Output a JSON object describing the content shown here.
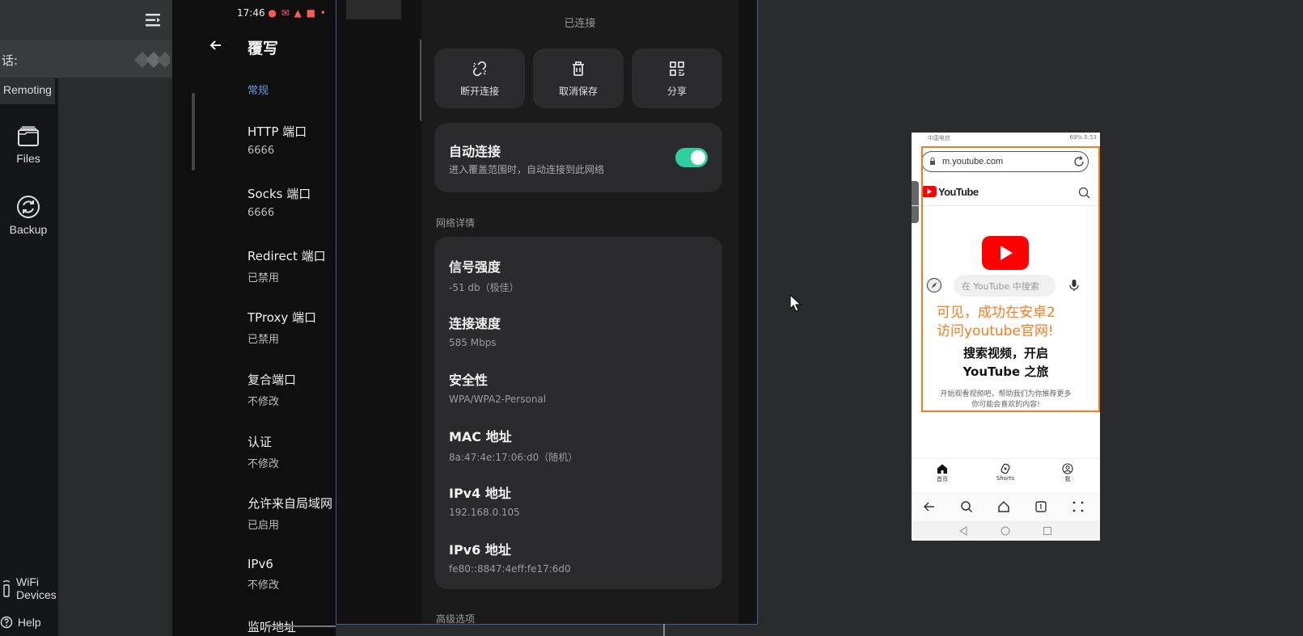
{
  "left_app": {
    "chat_label": "话:",
    "nav": {
      "remoting": "Remoting",
      "files": "Files",
      "backup": "Backup",
      "wifi_devices_line1": "WiFi",
      "wifi_devices_line2": "Devices",
      "help": "Help"
    }
  },
  "override": {
    "status_time": "17:46",
    "title": "覆写",
    "section": "常规",
    "options": [
      {
        "title": "HTTP 端口",
        "value": "6666"
      },
      {
        "title": "Socks 端口",
        "value": "6666"
      },
      {
        "title": "Redirect 端口",
        "value": "已禁用"
      },
      {
        "title": "TProxy 端口",
        "value": "已禁用"
      },
      {
        "title": "复合端口",
        "value": "不修改"
      },
      {
        "title": "认证",
        "value": "不修改"
      },
      {
        "title": "允许来自局域网",
        "value": "已启用"
      },
      {
        "title": "IPv6",
        "value": "不修改"
      },
      {
        "title": "监听地址",
        "value": ""
      }
    ]
  },
  "wifi_details": {
    "status": "已连接",
    "actions": {
      "disconnect": "断开连接",
      "forget": "取消保存",
      "share": "分享"
    },
    "auto_connect": {
      "title": "自动连接",
      "desc": "进入覆盖范围时，自动连接到此网络",
      "enabled": true
    },
    "section_details": "网络详情",
    "details": [
      {
        "title": "信号强度",
        "value": "-51 db（极佳）"
      },
      {
        "title": "连接速度",
        "value": "585 Mbps"
      },
      {
        "title": "安全性",
        "value": "WPA/WPA2-Personal"
      },
      {
        "title": "MAC 地址",
        "value": "8a:47:4e:17:06:d0（随机）"
      },
      {
        "title": "IPv4 地址",
        "value": "192.168.0.105"
      },
      {
        "title": "IPv6 地址",
        "value": "fe80::8847:4eff:fe17:6d0"
      }
    ],
    "section_advanced": "高级选项",
    "accent": "#2fcfa0"
  },
  "youtube_phone": {
    "status_left": "中国电信",
    "status_right": "69% 5:53",
    "url": "m.youtube.com",
    "logo_text": "YouTube",
    "search_placeholder": "在 YouTube 中搜索",
    "annotation_line1": "可见，成功在安卓2",
    "annotation_line2": "访问youtube官网!",
    "heading_line1": "搜索视频，开启",
    "heading_line2": "YouTube 之旅",
    "sub_line1": "开始观看视频吧，帮助我们为你推荐更多",
    "sub_line2": "你可能会喜欢的内容!",
    "nav": {
      "home": "首页",
      "shorts": "Shorts",
      "me": "我"
    },
    "annotation_color": "#f47c20",
    "brand_red": "#ff0000"
  }
}
